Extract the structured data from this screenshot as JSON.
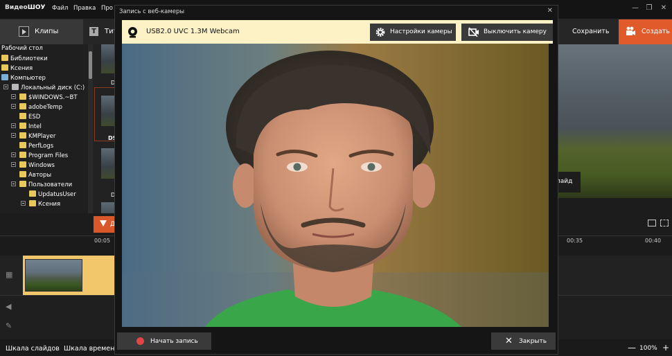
{
  "app": {
    "logo_part1": "Видео",
    "logo_part2": "ШОУ",
    "menu": [
      "Файл",
      "Правка",
      "Про"
    ],
    "window_controls": {
      "minimize": "—",
      "maximize": "❐",
      "close": "✕"
    }
  },
  "tabs": {
    "clips": "Клипы",
    "titles": "Тит",
    "save": "Сохранить",
    "create": "Создать"
  },
  "tree": [
    {
      "label": "Рабочий стол",
      "indent": 0,
      "icon": "none",
      "expander": false
    },
    {
      "label": "Библиотеки",
      "indent": 0,
      "icon": "folder",
      "expander": false
    },
    {
      "label": "Ксения",
      "indent": 0,
      "icon": "folder",
      "expander": false
    },
    {
      "label": "Компьютер",
      "indent": 0,
      "icon": "computer",
      "expander": false
    },
    {
      "label": "Локальный диск (C:)",
      "indent": 1,
      "icon": "disk",
      "expander": true
    },
    {
      "label": "$WINDOWS.~BT",
      "indent": 2,
      "icon": "folder",
      "expander": true
    },
    {
      "label": "adobeTemp",
      "indent": 2,
      "icon": "folder",
      "expander": true
    },
    {
      "label": "ESD",
      "indent": 2,
      "icon": "folder",
      "expander": false
    },
    {
      "label": "Intel",
      "indent": 2,
      "icon": "folder",
      "expander": true
    },
    {
      "label": "KMPlayer",
      "indent": 2,
      "icon": "folder",
      "expander": true
    },
    {
      "label": "PerfLogs",
      "indent": 2,
      "icon": "folder",
      "expander": false
    },
    {
      "label": "Program Files",
      "indent": 2,
      "icon": "folder",
      "expander": true
    },
    {
      "label": "Windows",
      "indent": 2,
      "icon": "folder",
      "expander": true
    },
    {
      "label": "Авторы",
      "indent": 2,
      "icon": "folder",
      "expander": false
    },
    {
      "label": "Пользователи",
      "indent": 2,
      "icon": "folder",
      "expander": true
    },
    {
      "label": "UpdatusUser",
      "indent": 3,
      "icon": "folder",
      "expander": false
    },
    {
      "label": "Ксения",
      "indent": 3,
      "icon": "folder",
      "expander": true
    }
  ],
  "thumb_labels": [
    "D",
    "DS",
    "D"
  ],
  "add_button_label": "Д",
  "preview_label": "лайд",
  "timeline": {
    "ruler": [
      "00:05",
      "00:35",
      "00:40"
    ]
  },
  "status": {
    "tab_slides": "Шкала слайдов",
    "tab_time": "Шкала времени",
    "zoom": "100%",
    "zoom_minus": "—",
    "zoom_plus": "+"
  },
  "dialog": {
    "title": "Запись с веб-камеры",
    "close_glyph": "✕",
    "camera_name": "USB2.0 UVC 1.3M Webcam",
    "settings_button": "Настройки камеры",
    "disable_button": "Выключить камеру",
    "record_button": "Начать запись",
    "close_button": "Закрыть"
  },
  "colors": {
    "accent_orange": "#e05a2b",
    "camera_bar": "#fcf2c6",
    "record_red": "#e24545",
    "clip_yellow": "#f2c66a"
  }
}
